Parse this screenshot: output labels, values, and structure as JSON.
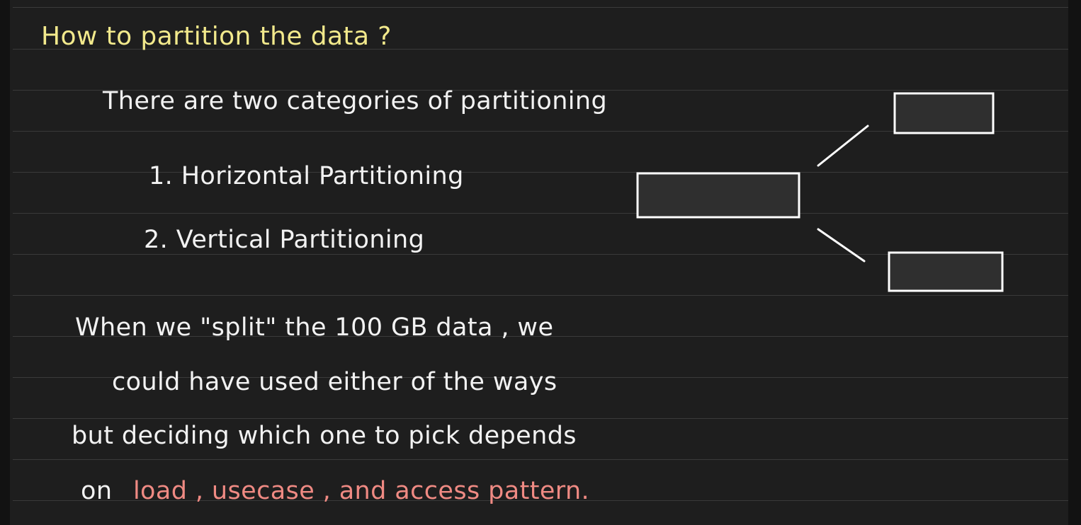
{
  "note": {
    "title": "How to partition the data ?",
    "intro": "There are two categories of partitioning",
    "items": [
      "1. Horizontal Partitioning",
      "2. Vertical Partitioning"
    ],
    "paragraph": {
      "line1": "When we \"split\" the 100 GB data , we",
      "line2": "could have used either of the ways",
      "line3": "but deciding which one to pick depends",
      "line4_prefix": "on",
      "line4_highlight": "load , usecase , and access pattern."
    }
  },
  "colors": {
    "title": "#f2e98c",
    "text": "#f2f2f2",
    "highlight": "#ef8a83",
    "box_fill": "#2f2f2f",
    "box_stroke": "#ffffff",
    "rules": "#3a3a3a",
    "background": "#1e1e1e"
  }
}
